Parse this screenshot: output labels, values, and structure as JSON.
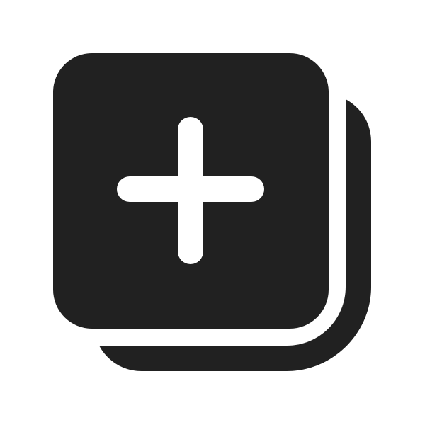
{
  "icon": {
    "name": "add-square-multiple-icon",
    "colors": {
      "foreground": "#212121",
      "background": "#ffffff",
      "plus": "#ffffff"
    }
  }
}
